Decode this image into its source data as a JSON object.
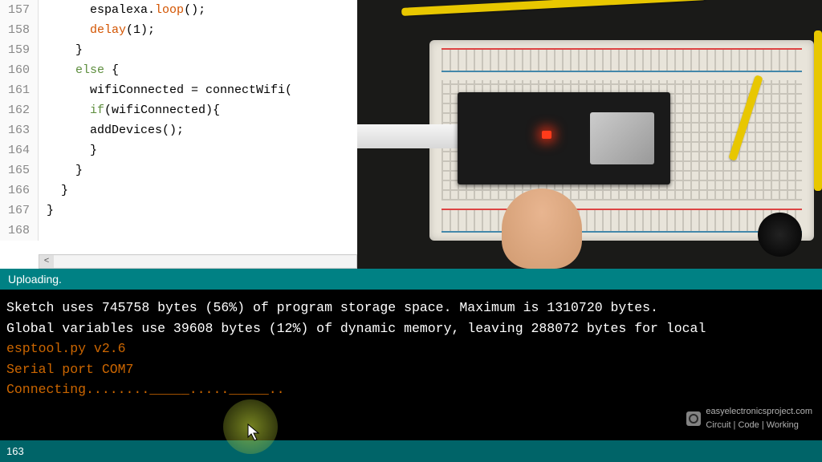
{
  "colors": {
    "statusTeal": "#008184",
    "footerTeal": "#006468",
    "consoleOrange": "#cc6600"
  },
  "code": {
    "lines": [
      {
        "num": "157",
        "indent": "      ",
        "segments": [
          {
            "t": "espalexa",
            "c": ""
          },
          {
            "t": ".",
            "c": ""
          },
          {
            "t": "loop",
            "c": "fn-orange"
          },
          {
            "t": "();",
            "c": ""
          }
        ]
      },
      {
        "num": "158",
        "indent": "      ",
        "segments": [
          {
            "t": "delay",
            "c": "fn-orange"
          },
          {
            "t": "(1);",
            "c": ""
          }
        ]
      },
      {
        "num": "159",
        "indent": "    ",
        "segments": [
          {
            "t": "}",
            "c": ""
          }
        ]
      },
      {
        "num": "160",
        "indent": "    ",
        "segments": [
          {
            "t": "else",
            "c": "kw-green"
          },
          {
            "t": " {",
            "c": ""
          }
        ]
      },
      {
        "num": "161",
        "indent": "      ",
        "segments": [
          {
            "t": "wifiConnected = connectWifi(",
            "c": ""
          }
        ]
      },
      {
        "num": "162",
        "indent": "      ",
        "segments": [
          {
            "t": "if",
            "c": "kw-green"
          },
          {
            "t": "(wifiConnected){",
            "c": ""
          }
        ]
      },
      {
        "num": "163",
        "indent": "      ",
        "segments": [
          {
            "t": "addDevices();",
            "c": ""
          }
        ]
      },
      {
        "num": "164",
        "indent": "      ",
        "segments": [
          {
            "t": "}",
            "c": ""
          }
        ]
      },
      {
        "num": "165",
        "indent": "    ",
        "segments": [
          {
            "t": "}",
            "c": ""
          }
        ]
      },
      {
        "num": "166",
        "indent": "  ",
        "segments": [
          {
            "t": "}",
            "c": ""
          }
        ]
      },
      {
        "num": "167",
        "indent": "",
        "segments": [
          {
            "t": "}",
            "c": ""
          }
        ]
      },
      {
        "num": "168",
        "indent": "",
        "segments": []
      }
    ]
  },
  "scroll_arrow_left": "<",
  "status": {
    "label": "Uploading."
  },
  "console": {
    "line1": "Sketch uses 745758 bytes (56%) of program storage space. Maximum is 1310720 bytes.",
    "line2": "Global variables use 39608 bytes (12%) of dynamic memory, leaving 288072 bytes for local",
    "line3": "esptool.py v2.6",
    "line4": "Serial port COM7",
    "line5": "Connecting........_____....._____.."
  },
  "watermark": {
    "site": "easyelectronicsproject.com",
    "tagline": "Circuit | Code | Working"
  },
  "footer": {
    "cursor_line": "163"
  }
}
